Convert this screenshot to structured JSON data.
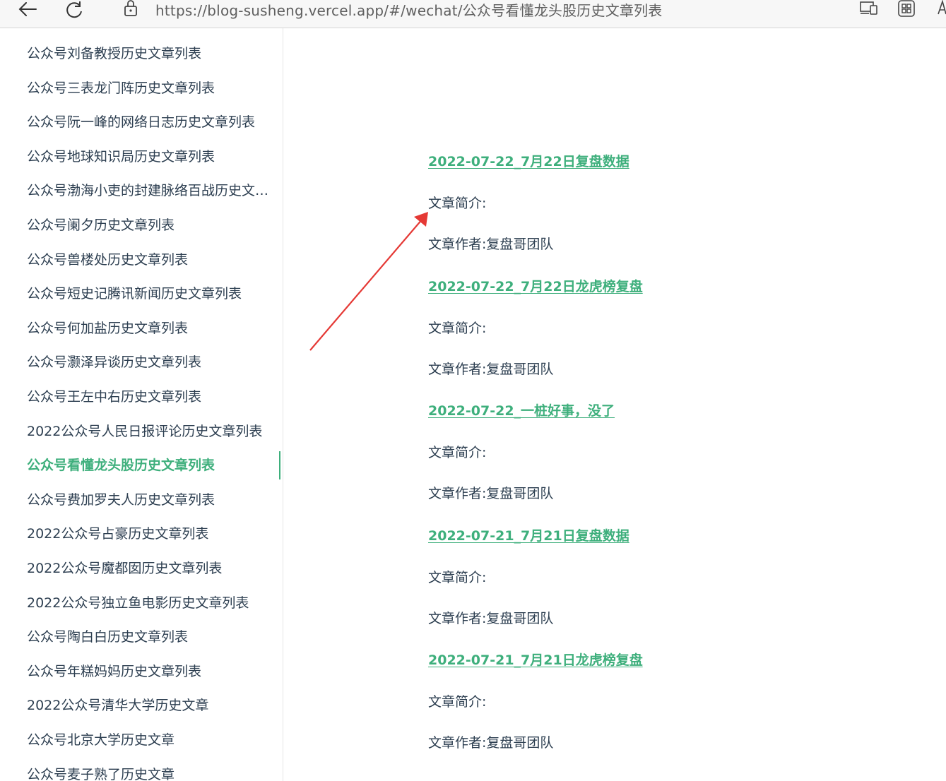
{
  "browser": {
    "url": "https://blog-susheng.vercel.app/#/wechat/公众号看懂龙头股历史文章列表"
  },
  "sidebar": {
    "items": [
      {
        "label": "公众号刘备教授历史文章列表"
      },
      {
        "label": "公众号三表龙门阵历史文章列表"
      },
      {
        "label": "公众号阮一峰的网络日志历史文章列表"
      },
      {
        "label": "公众号地球知识局历史文章列表"
      },
      {
        "label": "公众号渤海小吏的封建脉络百战历史文章…"
      },
      {
        "label": "公众号阑夕历史文章列表"
      },
      {
        "label": "公众号兽楼处历史文章列表"
      },
      {
        "label": "公众号短史记腾讯新闻历史文章列表"
      },
      {
        "label": "公众号何加盐历史文章列表"
      },
      {
        "label": "公众号灏泽异谈历史文章列表"
      },
      {
        "label": "公众号王左中右历史文章列表"
      },
      {
        "label": "2022公众号人民日报评论历史文章列表"
      },
      {
        "label": "公众号看懂龙头股历史文章列表",
        "active": true
      },
      {
        "label": "公众号费加罗夫人历史文章列表"
      },
      {
        "label": "2022公众号占豪历史文章列表"
      },
      {
        "label": "2022公众号魔都囡历史文章列表"
      },
      {
        "label": "2022公众号独立鱼电影历史文章列表"
      },
      {
        "label": "公众号陶白白历史文章列表"
      },
      {
        "label": "公众号年糕妈妈历史文章列表"
      },
      {
        "label": "2022公众号清华大学历史文章"
      },
      {
        "label": "公众号北京大学历史文章"
      },
      {
        "label": "公众号麦子熟了历史文章"
      }
    ]
  },
  "articles": [
    {
      "title": "2022-07-22_7月22日复盘数据",
      "intro": "文章简介:",
      "author": "文章作者:复盘哥团队"
    },
    {
      "title": "2022-07-22_7月22日龙虎榜复盘",
      "intro": "文章简介:",
      "author": "文章作者:复盘哥团队"
    },
    {
      "title": "2022-07-22_一桩好事，没了",
      "intro": "文章简介:",
      "author": "文章作者:复盘哥团队"
    },
    {
      "title": "2022-07-21_7月21日复盘数据",
      "intro": "文章简介:",
      "author": "文章作者:复盘哥团队"
    },
    {
      "title": "2022-07-21_7月21日龙虎榜复盘",
      "intro": "文章简介:",
      "author": "文章作者:复盘哥团队"
    }
  ],
  "colors": {
    "accent": "#3eaf7c",
    "text": "#2c3e50",
    "arrow": "#e53935"
  }
}
